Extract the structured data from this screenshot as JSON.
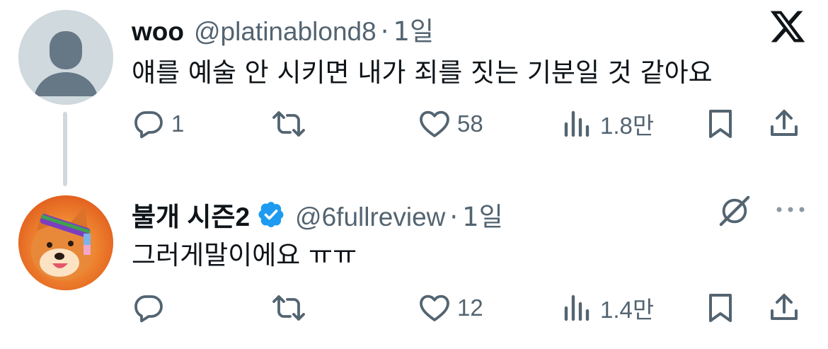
{
  "tweets": [
    {
      "name": "woo",
      "handle": "@platinablond8",
      "separator": "·",
      "time": "1일",
      "text": "얘를 예술 안 시키면 내가 죄를 짓는 기분일 것 같아요",
      "reply_count": "1",
      "retweet_count": "",
      "like_count": "58",
      "view_count": "1.8만",
      "avatar": "default-avatar"
    },
    {
      "name": "불개 시즌2",
      "verified": true,
      "handle": "@6fullreview",
      "separator": "·",
      "time": "1일",
      "text": "그러게말이에요 ㅠㅠ",
      "reply_count": "",
      "retweet_count": "",
      "like_count": "12",
      "view_count": "1.4만",
      "avatar": "shiba-dog-avatar"
    }
  ],
  "icons": {
    "app": "x-logo-icon",
    "grok": "grok-icon",
    "more": "more-icon",
    "reply": "reply-icon",
    "retweet": "retweet-icon",
    "like": "heart-icon",
    "views": "views-icon",
    "bookmark": "bookmark-icon",
    "share": "share-icon"
  },
  "colors": {
    "text": "#0f1419",
    "secondary": "#536471",
    "verified": "#1d9bf0",
    "thread_line": "#cfd9de"
  }
}
